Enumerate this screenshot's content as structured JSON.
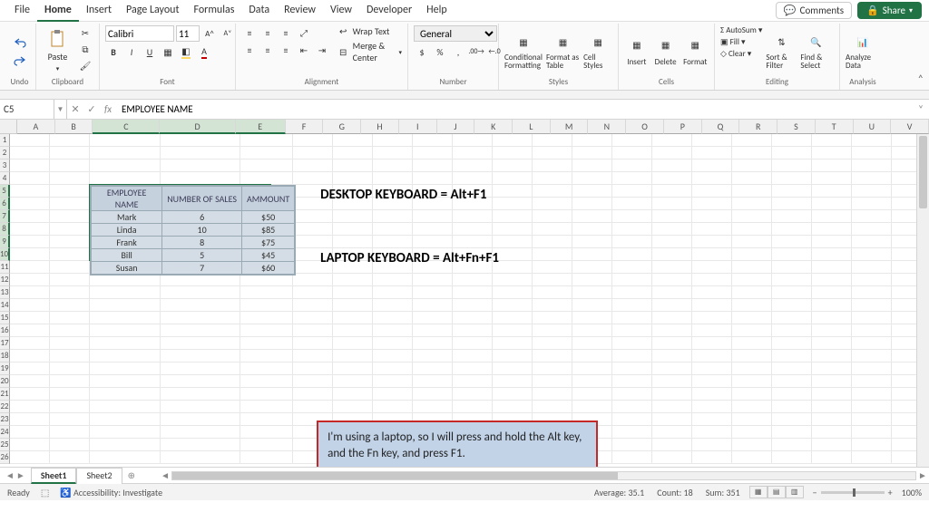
{
  "menu": {
    "tabs": [
      "File",
      "Home",
      "Insert",
      "Page Layout",
      "Formulas",
      "Data",
      "Review",
      "View",
      "Developer",
      "Help"
    ],
    "active": "Home",
    "comments": "Comments",
    "share": "Share"
  },
  "ribbon": {
    "undo_label": "Undo",
    "clipboard": {
      "paste": "Paste",
      "label": "Clipboard"
    },
    "font": {
      "name": "Calibri",
      "size": "11",
      "label": "Font"
    },
    "alignment": {
      "wrap": "Wrap Text",
      "merge": "Merge & Center",
      "label": "Alignment"
    },
    "number": {
      "format": "General",
      "label": "Number"
    },
    "styles": {
      "cond": "Conditional Formatting",
      "fmttbl": "Format as Table",
      "cellstyles": "Cell Styles",
      "label": "Styles"
    },
    "cells": {
      "insert": "Insert",
      "delete": "Delete",
      "format": "Format",
      "label": "Cells"
    },
    "editing": {
      "autosum": "AutoSum",
      "fill": "Fill",
      "clear": "Clear",
      "sort": "Sort & Filter",
      "find": "Find & Select",
      "label": "Editing"
    },
    "analysis": {
      "analyze": "Analyze Data",
      "label": "Analysis"
    }
  },
  "formula_bar": {
    "name_box": "C5",
    "fx": "fx",
    "value": "EMPLOYEE NAME"
  },
  "columns": [
    "A",
    "B",
    "C",
    "D",
    "E",
    "F",
    "G",
    "H",
    "I",
    "J",
    "K",
    "L",
    "M",
    "N",
    "O",
    "P",
    "Q",
    "R",
    "S",
    "T",
    "U",
    "V"
  ],
  "selected_cols": [
    "C",
    "D",
    "E"
  ],
  "selected_rows": [
    5,
    6,
    7,
    8,
    9,
    10
  ],
  "chart_data": {
    "type": "table",
    "columns": [
      "EMPLOYEE NAME",
      "NUMBER OF SALES",
      "AMMOUNT"
    ],
    "rows": [
      [
        "Mark",
        "6",
        "$50"
      ],
      [
        "Linda",
        "10",
        "$85"
      ],
      [
        "Frank",
        "8",
        "$75"
      ],
      [
        "Bill",
        "5",
        "$45"
      ],
      [
        "Susan",
        "7",
        "$60"
      ]
    ]
  },
  "labels": {
    "desktop": "DESKTOP KEYBOARD = Alt+F1",
    "laptop": "LAPTOP KEYBOARD = Alt+Fn+F1"
  },
  "callout": "I'm using a laptop, so I will press and hold the Alt key, and the Fn key, and press F1.",
  "sheets": {
    "tabs": [
      "Sheet1",
      "Sheet2"
    ],
    "active": "Sheet1"
  },
  "status": {
    "ready": "Ready",
    "access": "Accessibility: Investigate",
    "avg": "Average: 35.1",
    "count": "Count: 18",
    "sum": "Sum: 351",
    "zoom": "100%"
  }
}
